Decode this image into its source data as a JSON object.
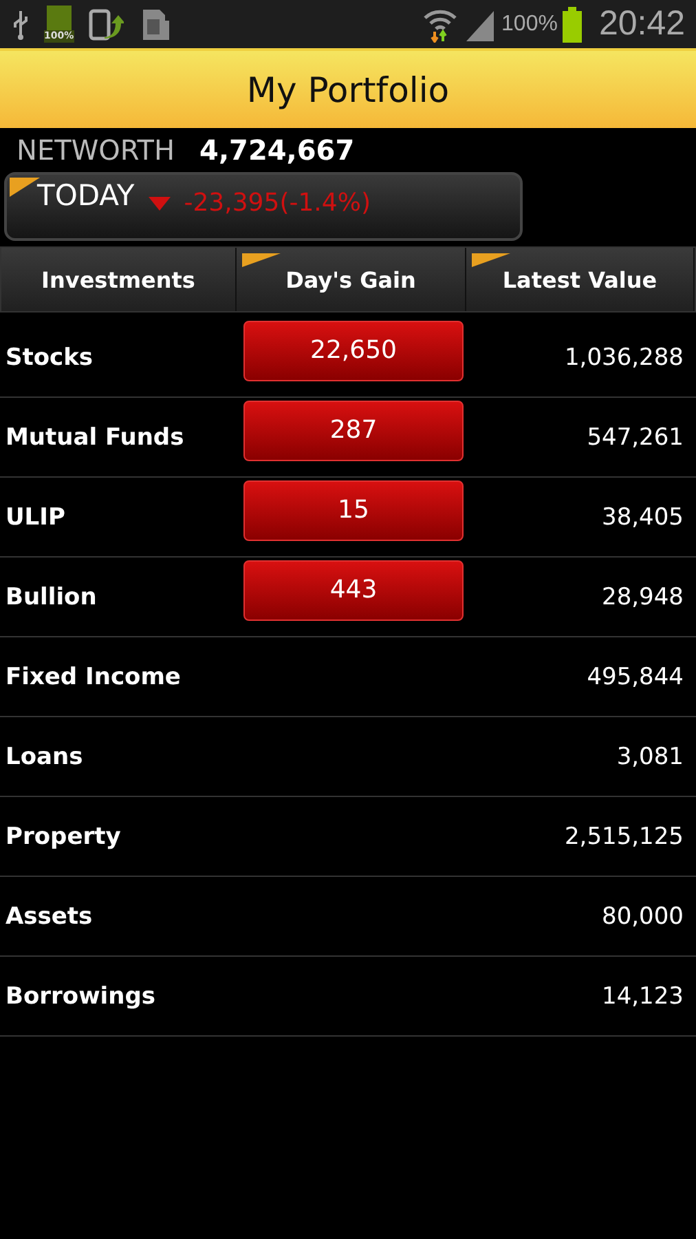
{
  "status_bar": {
    "battery_icon_label": "100%",
    "battery": "100%",
    "time": "20:42"
  },
  "title": "My Portfolio",
  "networth": {
    "label": "NETWORTH",
    "value": "4,724,667"
  },
  "today": {
    "label": "TODAY",
    "falling": true,
    "change": "-23,395(-1.4%)"
  },
  "columns": [
    {
      "label": "Investments",
      "marker": false
    },
    {
      "label": "Day's Gain",
      "marker": true
    },
    {
      "label": "Latest Value",
      "marker": true
    }
  ],
  "rows": [
    {
      "name": "Stocks",
      "gain": "22,650",
      "value": "1,036,288"
    },
    {
      "name": "Mutual Funds",
      "gain": "287",
      "value": "547,261"
    },
    {
      "name": "ULIP",
      "gain": "15",
      "value": "38,405"
    },
    {
      "name": "Bullion",
      "gain": "443",
      "value": "28,948"
    },
    {
      "name": "Fixed Income",
      "value": "495,844"
    },
    {
      "name": "Loans",
      "value": "3,081"
    },
    {
      "name": "Property",
      "value": "2,515,125"
    },
    {
      "name": "Assets",
      "value": "80,000"
    },
    {
      "name": "Borrowings",
      "value": "14,123"
    }
  ]
}
